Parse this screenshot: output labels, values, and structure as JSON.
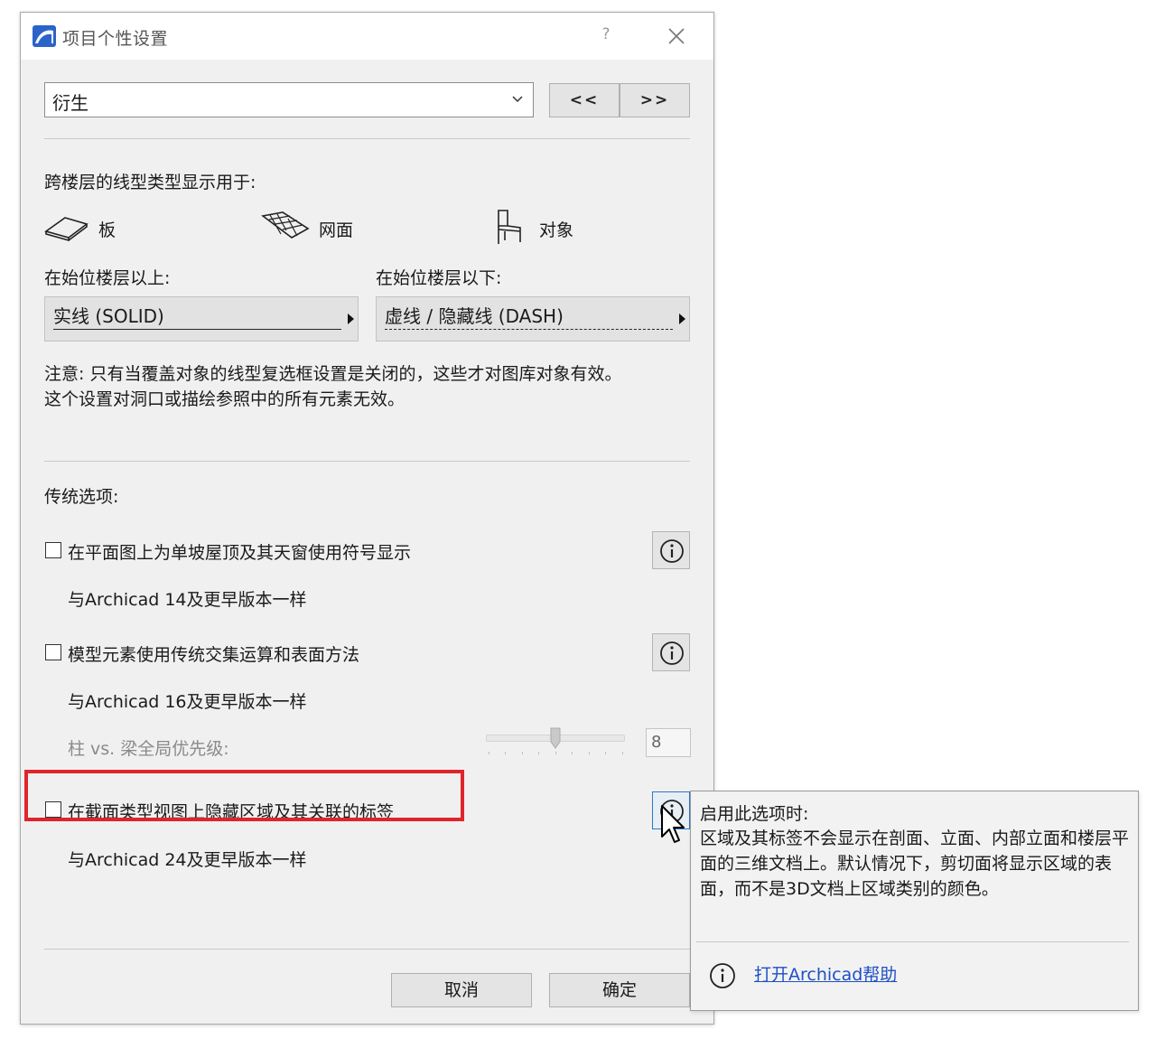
{
  "window": {
    "title": "项目个性设置",
    "help_glyph": "?"
  },
  "preset": {
    "selected": "衍生",
    "prev_label": "<<",
    "next_label": ">>"
  },
  "linetype_section": {
    "heading": "跨楼层的线型类型显示用于:",
    "types": [
      {
        "icon": "slab-icon",
        "label": "板"
      },
      {
        "icon": "mesh-icon",
        "label": "网面"
      },
      {
        "icon": "chair-object-icon",
        "label": "对象"
      }
    ],
    "above_label": "在始位楼层以上:",
    "below_label": "在始位楼层以下:",
    "above_value": "实线 (SOLID)",
    "below_value": "虚线 / 隐藏线 (DASH)",
    "note_line1": "注意: 只有当覆盖对象的线型复选框设置是关闭的，这些才对图库对象有效。",
    "note_line2": "这个设置对洞口或描绘参照中的所有元素无效。"
  },
  "legacy": {
    "heading": "传统选项:",
    "option1": {
      "label": "在平面图上为单坡屋顶及其天窗使用符号显示",
      "sub": "与Archicad 14及更早版本一样",
      "checked": false
    },
    "option2": {
      "label": "模型元素使用传统交集运算和表面方法",
      "sub": "与Archicad 16及更早版本一样",
      "checked": false
    },
    "priority": {
      "label": "柱 vs. 梁全局优先级:",
      "value": "8"
    },
    "option3": {
      "label": "在截面类型视图上隐藏区域及其关联的标签",
      "sub": "与Archicad 24及更早版本一样",
      "checked": false
    }
  },
  "footer": {
    "cancel_label": "取消",
    "ok_label": "确定"
  },
  "tooltip": {
    "title": "启用此选项时:",
    "body": "区域及其标签不会显示在剖面、立面、内部立面和楼层平面的三维文档上。默认情况下，剪切面将显示区域的表面，而不是3D文档上区域类别的颜色。",
    "help_link": "打开Archicad帮助"
  },
  "colors": {
    "highlight": "#e0242b",
    "link": "#1f4fc6",
    "app_logo": "#2b63c9"
  }
}
